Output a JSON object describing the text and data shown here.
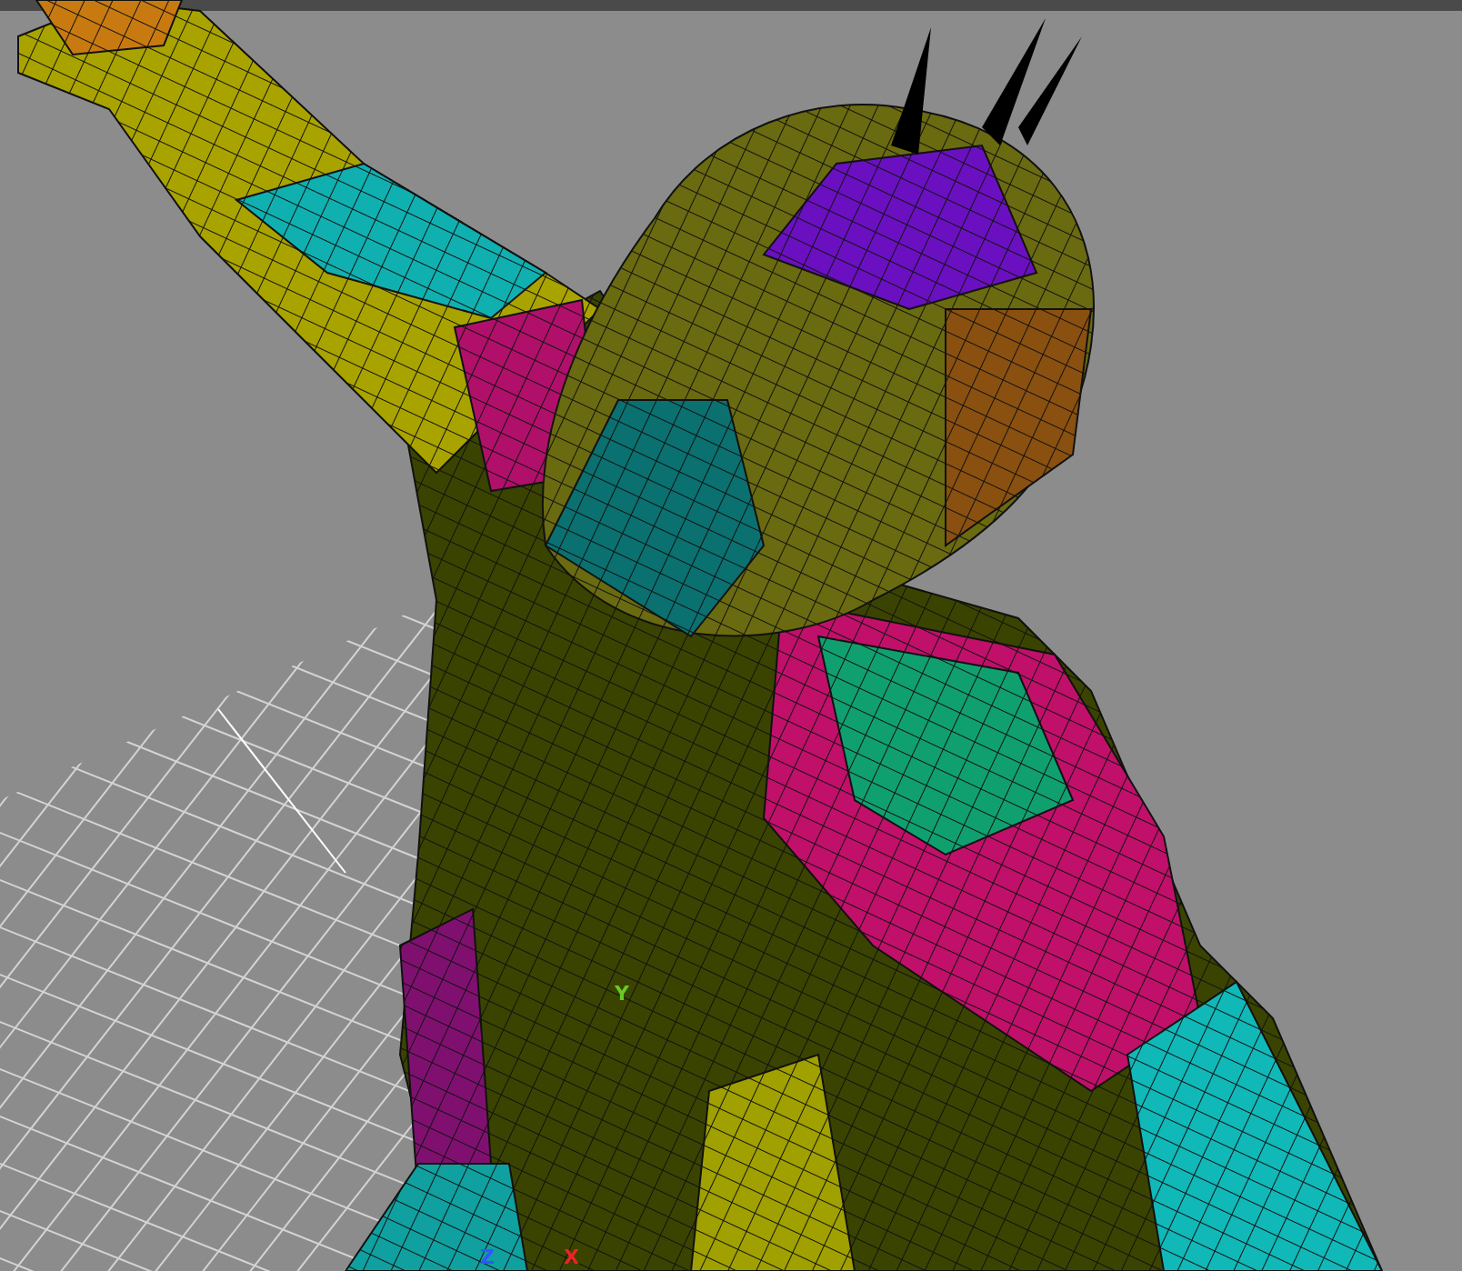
{
  "viewport": {
    "axis_labels": [
      {
        "text": "Y",
        "color": "#66cc22"
      },
      {
        "text": "Z",
        "color": "#3355ff"
      },
      {
        "text": "X",
        "color": "#ee2222"
      }
    ]
  }
}
